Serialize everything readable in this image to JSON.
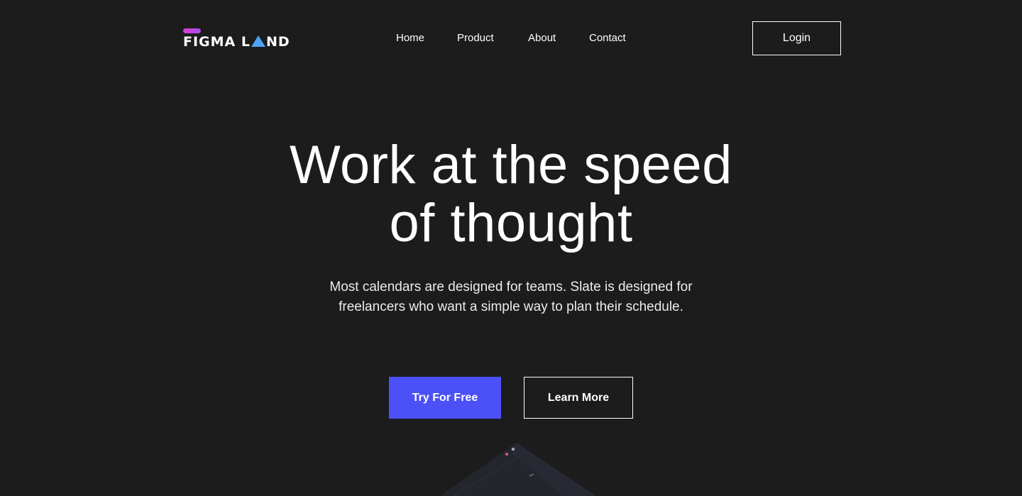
{
  "header": {
    "logo": {
      "text_left": "FIGMA L",
      "text_right": "ND",
      "wordmark": "FIGMA LAND"
    },
    "nav": [
      {
        "label": "Home"
      },
      {
        "label": "Product"
      },
      {
        "label": "About"
      },
      {
        "label": "Contact"
      }
    ],
    "login_label": "Login"
  },
  "hero": {
    "title_line1": "Work at the speed",
    "title_line2": "of thought",
    "subtitle_line1": "Most calendars are designed for teams. Slate is designed for",
    "subtitle_line2": "freelancers who want a simple way to plan their schedule.",
    "primary_cta": "Try For Free",
    "secondary_cta": "Learn More"
  },
  "colors": {
    "background": "#1c1c1d",
    "primary_button": "#4b51f7",
    "logo_pill": "#d93fd0",
    "logo_triangle": "#4fa3f7",
    "text": "#ffffff"
  },
  "icons": {
    "logo_mark": "triangle-icon",
    "logo_accent": "pill-icon"
  }
}
